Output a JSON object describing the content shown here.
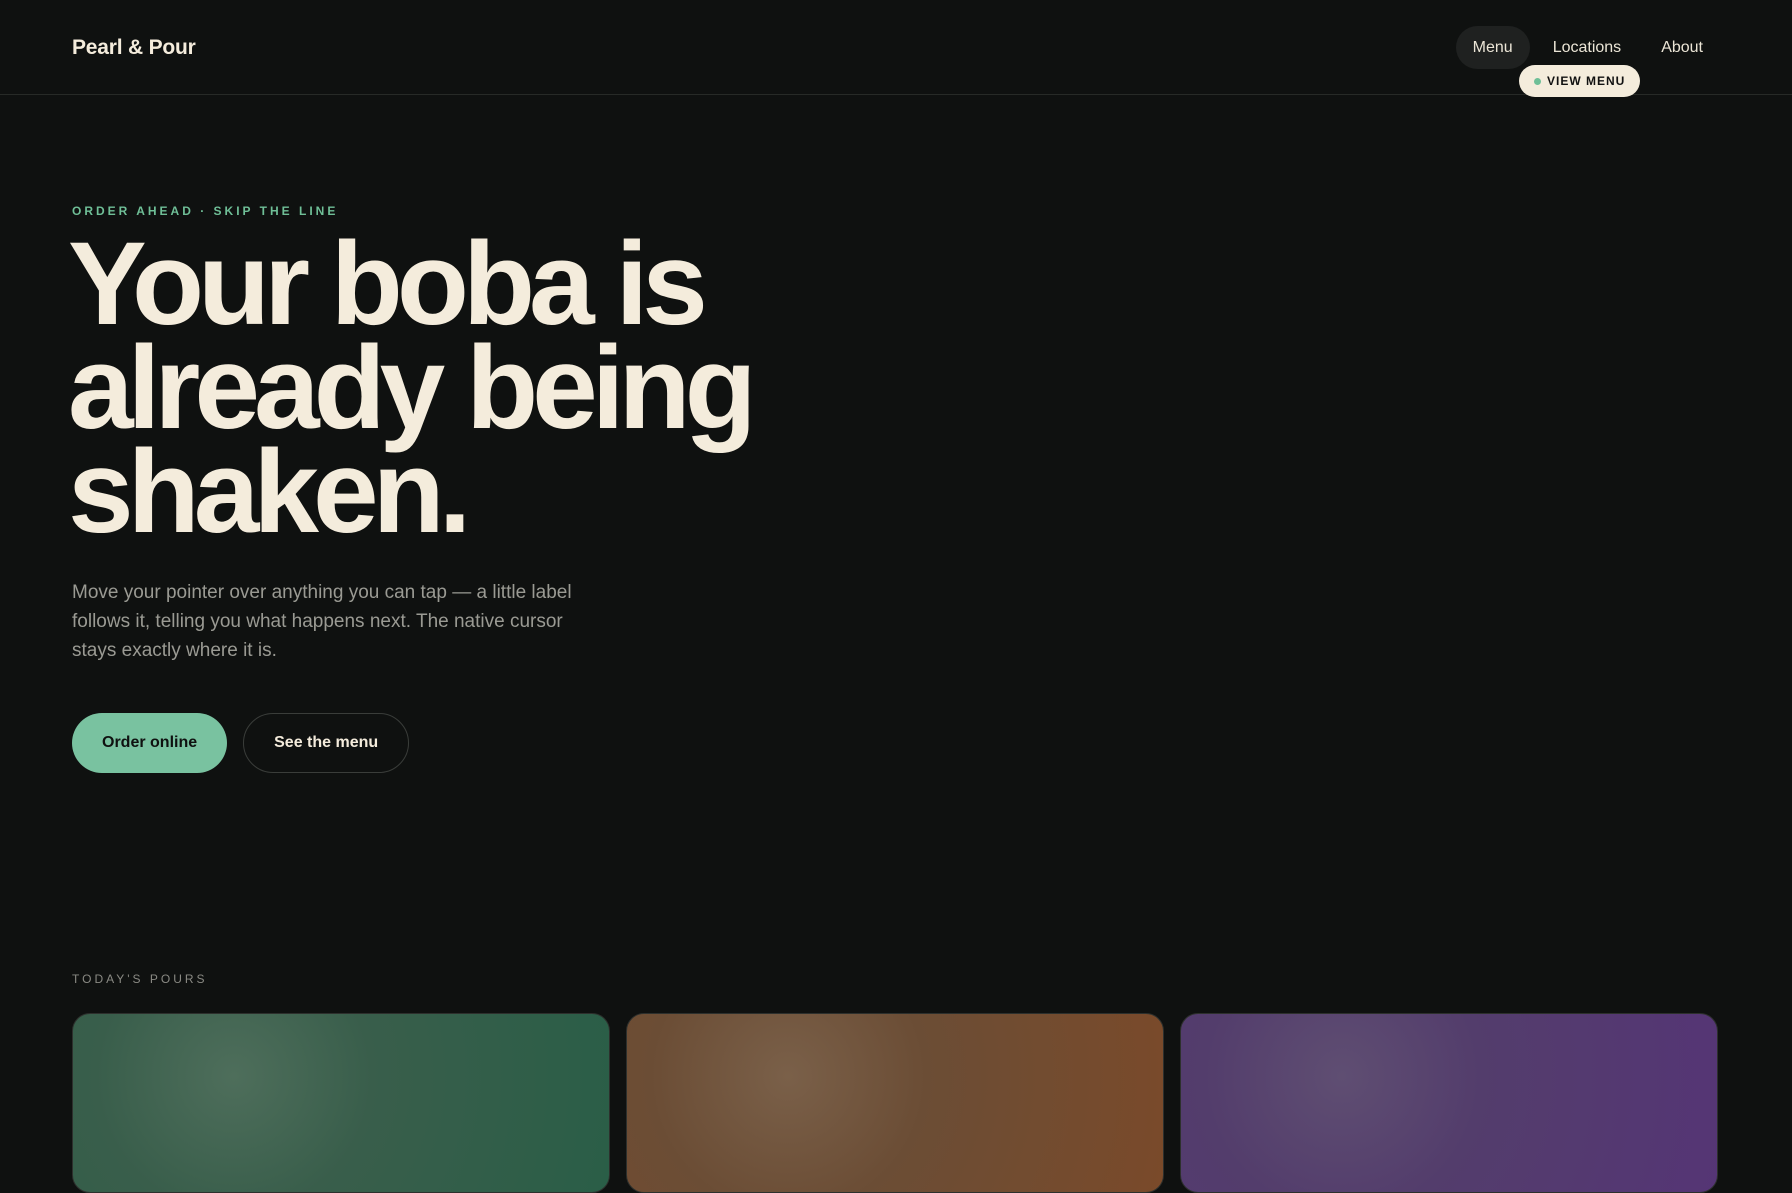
{
  "header": {
    "brand": "Pearl & Pour",
    "nav": [
      {
        "label": "Menu",
        "active": true
      },
      {
        "label": "Locations",
        "active": false
      },
      {
        "label": "About",
        "active": false
      }
    ],
    "cursor_label": "VIEW MENU"
  },
  "hero": {
    "eyebrow": "ORDER AHEAD · SKIP THE LINE",
    "headline_lines": [
      "Your boba is",
      "already being",
      "shaken."
    ],
    "lede": "Move your pointer over anything you can tap — a little label follows it, telling you what happens next. The native cursor stays exactly where it is.",
    "primary_cta": "Order online",
    "secondary_cta": "See the menu"
  },
  "pours": {
    "label": "TODAY'S POURS"
  },
  "colors": {
    "background": "#0f1110",
    "accent": "#79c2a0",
    "cream": "#f4ecdc"
  }
}
